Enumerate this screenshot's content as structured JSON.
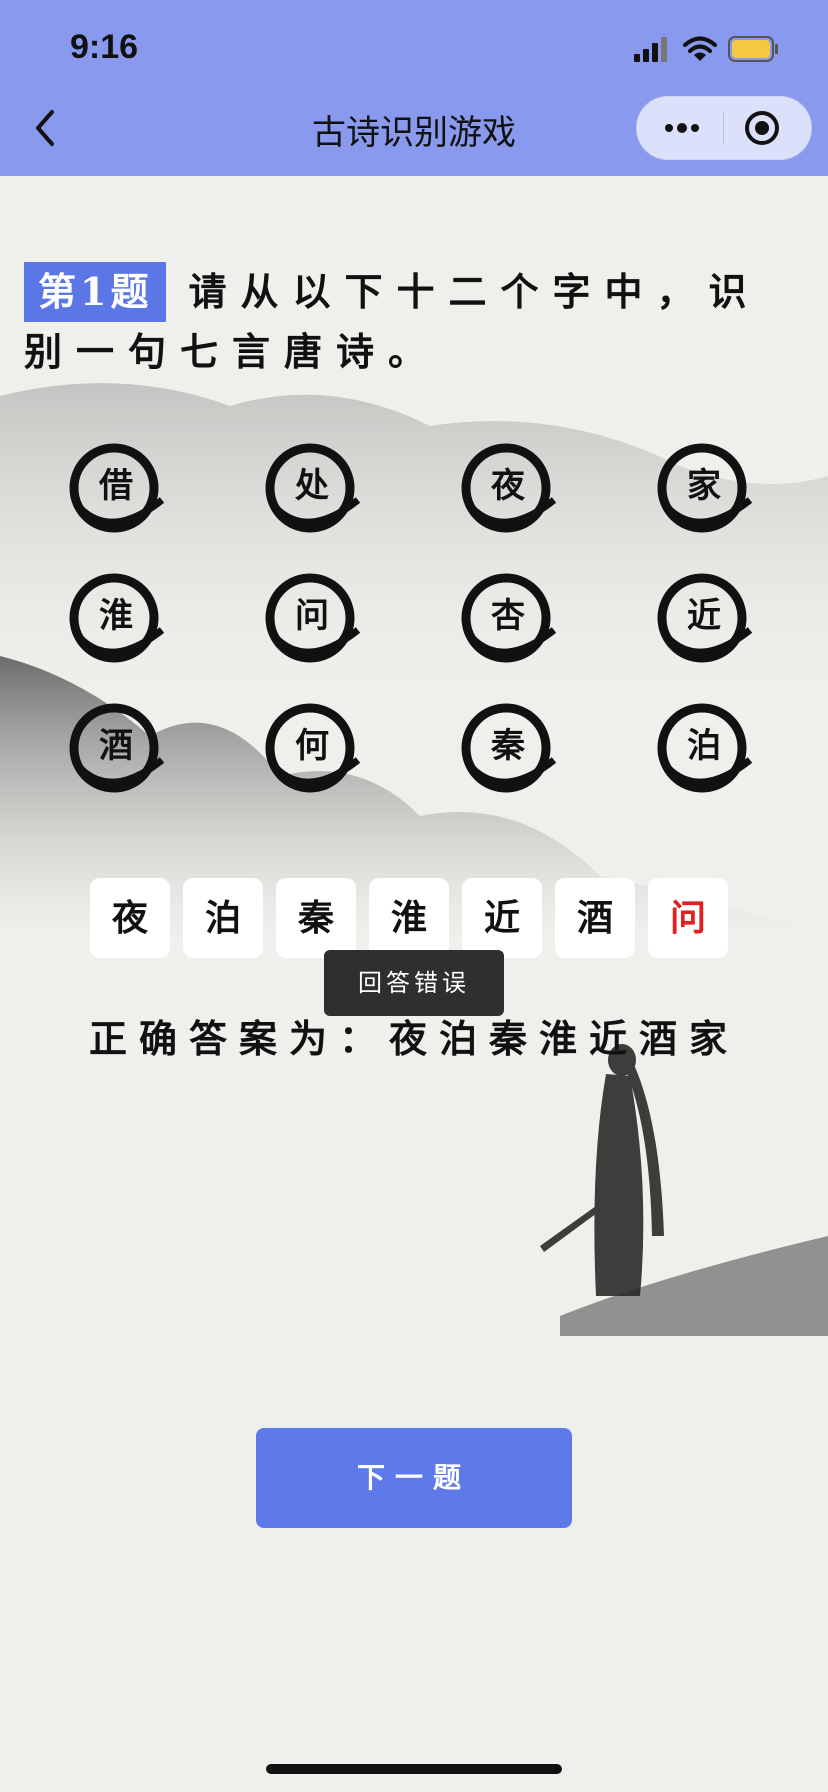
{
  "status_bar": {
    "time": "9:16"
  },
  "nav": {
    "title": "古诗识别游戏"
  },
  "question": {
    "number_label": "第1题",
    "prompt": "请从以下十二个字中，识别一句七言唐诗。"
  },
  "characters": [
    "借",
    "处",
    "夜",
    "家",
    "淮",
    "问",
    "杏",
    "近",
    "酒",
    "何",
    "秦",
    "泊"
  ],
  "answer": {
    "selected": [
      "夜",
      "泊",
      "秦",
      "淮",
      "近",
      "酒",
      "问"
    ],
    "wrong_index": 6
  },
  "toast": "回答错误",
  "correct_answer_text": "正确答案为：夜泊秦淮近酒家",
  "next_button": "下一题",
  "colors": {
    "accent": "#5e79ea",
    "nav_bg": "#8899ee",
    "wrong": "#e22020"
  }
}
